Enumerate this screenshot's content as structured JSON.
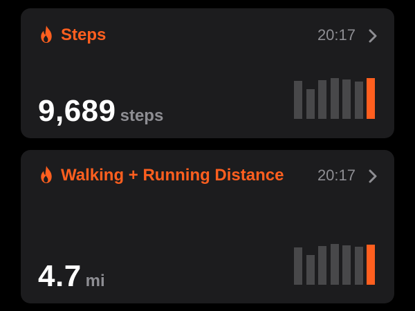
{
  "steps_card": {
    "title": "Steps",
    "time": "20:17",
    "value": "9,689",
    "unit": "steps",
    "chart": [
      0.78,
      0.61,
      0.8,
      0.84,
      0.82,
      0.77,
      0.84
    ],
    "highlight_index": 6
  },
  "distance_card": {
    "title": "Walking + Running Distance",
    "time": "20:17",
    "value": "4.7",
    "unit": "mi",
    "chart": [
      0.77,
      0.61,
      0.8,
      0.84,
      0.82,
      0.79,
      0.83
    ],
    "highlight_index": 6
  },
  "colors": {
    "accent": "#ff5f1f",
    "card_bg": "#1c1c1e",
    "bar_inactive": "#48484a",
    "secondary_text": "#8e8e93"
  },
  "icons": {
    "title": "flame-icon",
    "disclosure": "chevron-right-icon"
  }
}
